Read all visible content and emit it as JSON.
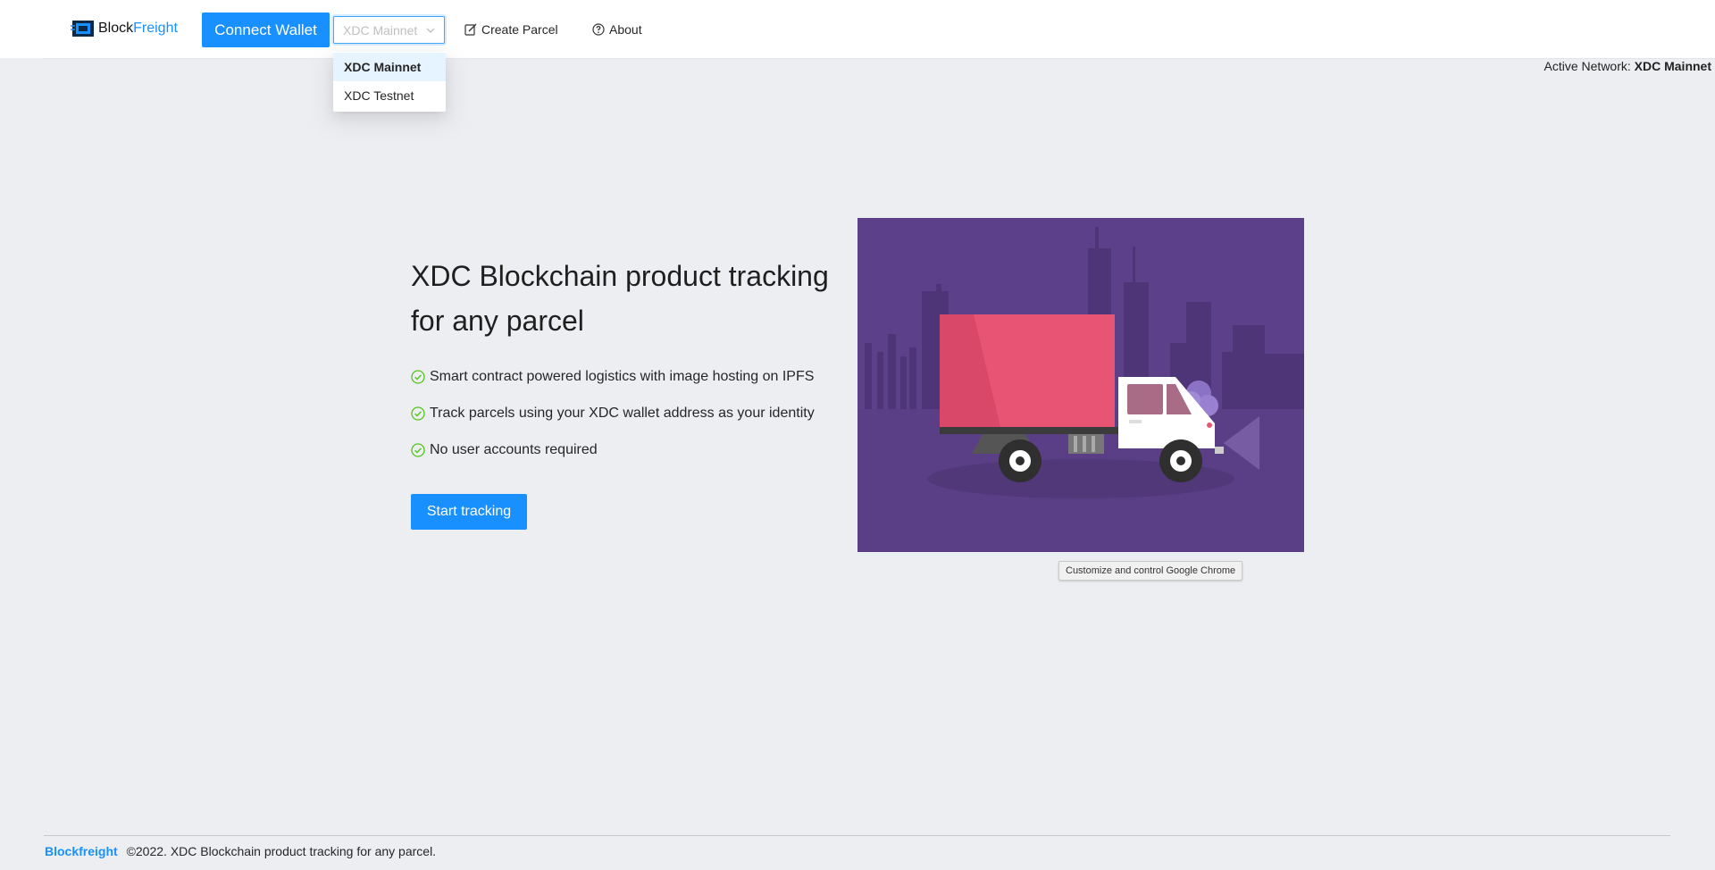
{
  "header": {
    "logo": {
      "block": "Block",
      "freight": "Freight"
    },
    "connect_wallet_label": "Connect Wallet",
    "network_select": {
      "selected": "XDC Mainnet",
      "options": [
        "XDC Mainnet",
        "XDC Testnet"
      ]
    },
    "nav": {
      "create_parcel": "Create Parcel",
      "about": "About"
    }
  },
  "status": {
    "active_network_label": "Active Network:",
    "active_network_value": "XDC Mainnet"
  },
  "hero": {
    "title": "XDC Blockchain product tracking for any parcel",
    "features": [
      "Smart contract powered logistics with image hosting on IPFS",
      "Track parcels using your XDC wallet address as your identity",
      "No user accounts required"
    ],
    "cta_label": "Start tracking"
  },
  "tooltip": {
    "text": "Customize and control Google Chrome"
  },
  "footer": {
    "brand": "Blockfreight",
    "text": "©2022. XDC Blockchain product tracking for any parcel."
  },
  "icons": {
    "create_parcel": "edit-icon",
    "about": "question-circle-icon",
    "feature": "check-circle-icon",
    "select": "chevron-down-icon"
  },
  "colors": {
    "primary": "#1890ff",
    "background": "#eceef2",
    "check": "#52c41a",
    "illustration_bg": "#5c418a",
    "truck_box": "#e85474"
  }
}
